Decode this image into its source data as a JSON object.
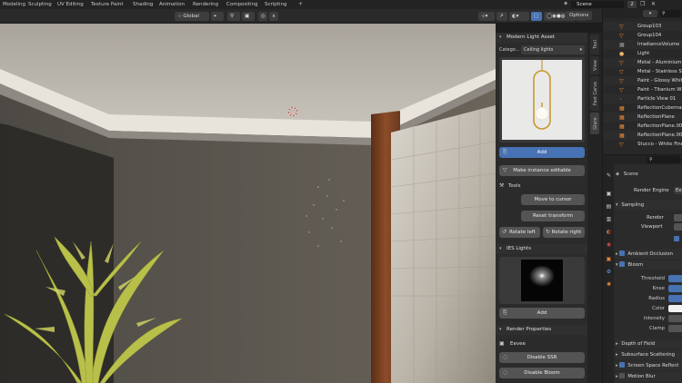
{
  "menubar": {
    "items": [
      "Modeling",
      "Sculpting",
      "UV Editing",
      "Texture Paint",
      "Shading",
      "Animation",
      "Rendering",
      "Compositing",
      "Scripting"
    ],
    "active_index": -1,
    "scene_label": "Scene",
    "scene_count": "2"
  },
  "viewport_header": {
    "orientation": "Global",
    "options_label": "Options"
  },
  "npanel": {
    "asset_title": "Modern Light Asset",
    "category_label": "Catego...",
    "category_value": "Ceiling lights",
    "add_label": "Add",
    "make_instance_label": "Make instance editable",
    "tools_title": "Tools",
    "move_to_cursor_label": "Move to cursor",
    "reset_transform_label": "Reset transform",
    "rotate_left_label": "Rotate left",
    "rotate_right_label": "Rotate right",
    "ies_title": "IES Lights",
    "ies_add_label": "Add",
    "render_props_title": "Render Properties",
    "engine_label": "Eevee",
    "disable_ssr_label": "Disable SSR",
    "disable_bloom_label": "Disable Bloom"
  },
  "side_tabs": [
    "Tool",
    "View",
    "Fast Carve",
    "Glare"
  ],
  "outliner": {
    "rows": [
      "Group103",
      "Group104",
      "IrradianceVolume",
      "Light",
      "Metal - Aluminium",
      "Metal - Stainless St",
      "Paint - Glossy White",
      "Paint - Titanium Wh",
      "Particle View 01",
      "ReflectionCubemap",
      "ReflectionPlane",
      "ReflectionPlane.001",
      "ReflectionPlane.002",
      "Stucco - White Fine"
    ]
  },
  "properties": {
    "scene_label": "Scene",
    "render_engine_label": "Render Engine",
    "render_engine_value": "Eeve",
    "sampling_label": "Sampling",
    "render_label": "Render",
    "viewport_label": "Viewport",
    "ambient_occlusion_label": "Ambient Occlusion",
    "bloom_label": "Bloom",
    "threshold_label": "Threshold",
    "knee_label": "Knee",
    "radius_label": "Radius",
    "color_label": "Color",
    "intensity_label": "Intensity",
    "clamp_label": "Clamp",
    "depth_of_field_label": "Depth of Field",
    "subsurface_label": "Subsurface Scattering",
    "ssr_label": "Screen Space Reflect",
    "motion_blur_label": "Motion Blur"
  },
  "colors": {
    "accent_blue": "#4772b3",
    "panel_bg": "#2b2b2b",
    "header_bg": "#232323"
  }
}
